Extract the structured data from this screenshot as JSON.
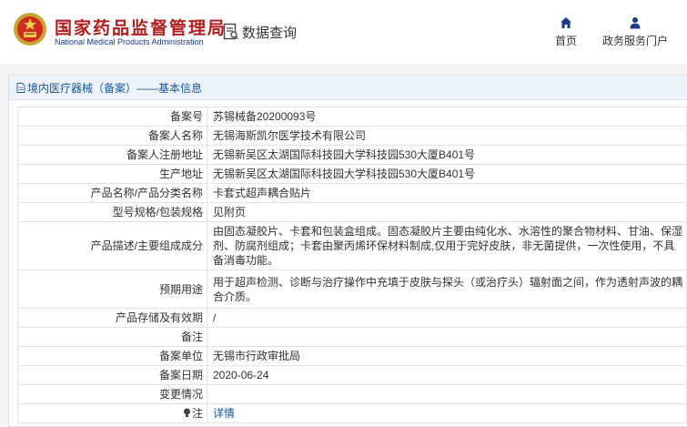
{
  "header": {
    "logo_cn": "国家药品监督管理局",
    "logo_en": "National Medical Products Administration",
    "data_query": "数据查询",
    "nav_home": "首页",
    "nav_gov": "政务服务门户"
  },
  "panel": {
    "breadcrumb": "境内医疗器械（备案）——基本信息"
  },
  "rows": [
    {
      "label": "备案号",
      "value": "苏锡械备20200093号"
    },
    {
      "label": "备案人名称",
      "value": "无锡海斯凯尔医学技术有限公司"
    },
    {
      "label": "备案人注册地址",
      "value": "无锡新吴区太湖国际科技园大学科技园530大厦B401号"
    },
    {
      "label": "生产地址",
      "value": "无锡新吴区太湖国际科技园大学科技园530大厦B401号"
    },
    {
      "label": "产品名称/产品分类名称",
      "value": "卡套式超声耦合贴片"
    },
    {
      "label": "型号规格/包装规格",
      "value": "见附页"
    },
    {
      "label": "产品描述/主要组成成分",
      "value": "由固态凝胶片、卡套和包装盒组成。固态凝胶片主要由纯化水、水溶性的聚合物材料、甘油、保湿剂、防腐剂组成；卡套由聚丙烯环保材料制成,仅用于完好皮肤，非无菌提供，一次性使用，不具备消毒功能。"
    },
    {
      "label": "预期用途",
      "value": "用于超声检测、诊断与治疗操作中充填于皮肤与探头（或治疗头）辐射面之间，作为透射声波的耦合介质。"
    },
    {
      "label": "产品存储及有效期",
      "value": "/"
    },
    {
      "label": "备注",
      "value": ""
    },
    {
      "label": "备案单位",
      "value": "无锡市行政审批局"
    },
    {
      "label": "备案日期",
      "value": "2020-06-24"
    },
    {
      "label": "变更情况",
      "value": ""
    },
    {
      "label": "注",
      "value": "详情"
    }
  ],
  "colors": {
    "brand_red": "#b21c1c",
    "brand_blue": "#1c3a8a",
    "link_blue": "#1a56a0",
    "panel_head_bg": "#eef3f9"
  },
  "icons": {
    "emblem": "national-emblem-icon",
    "data_query": "document-search-icon",
    "home": "home-icon",
    "gov": "person-icon",
    "breadcrumb": "document-icon",
    "note": "lightbulb-icon"
  }
}
